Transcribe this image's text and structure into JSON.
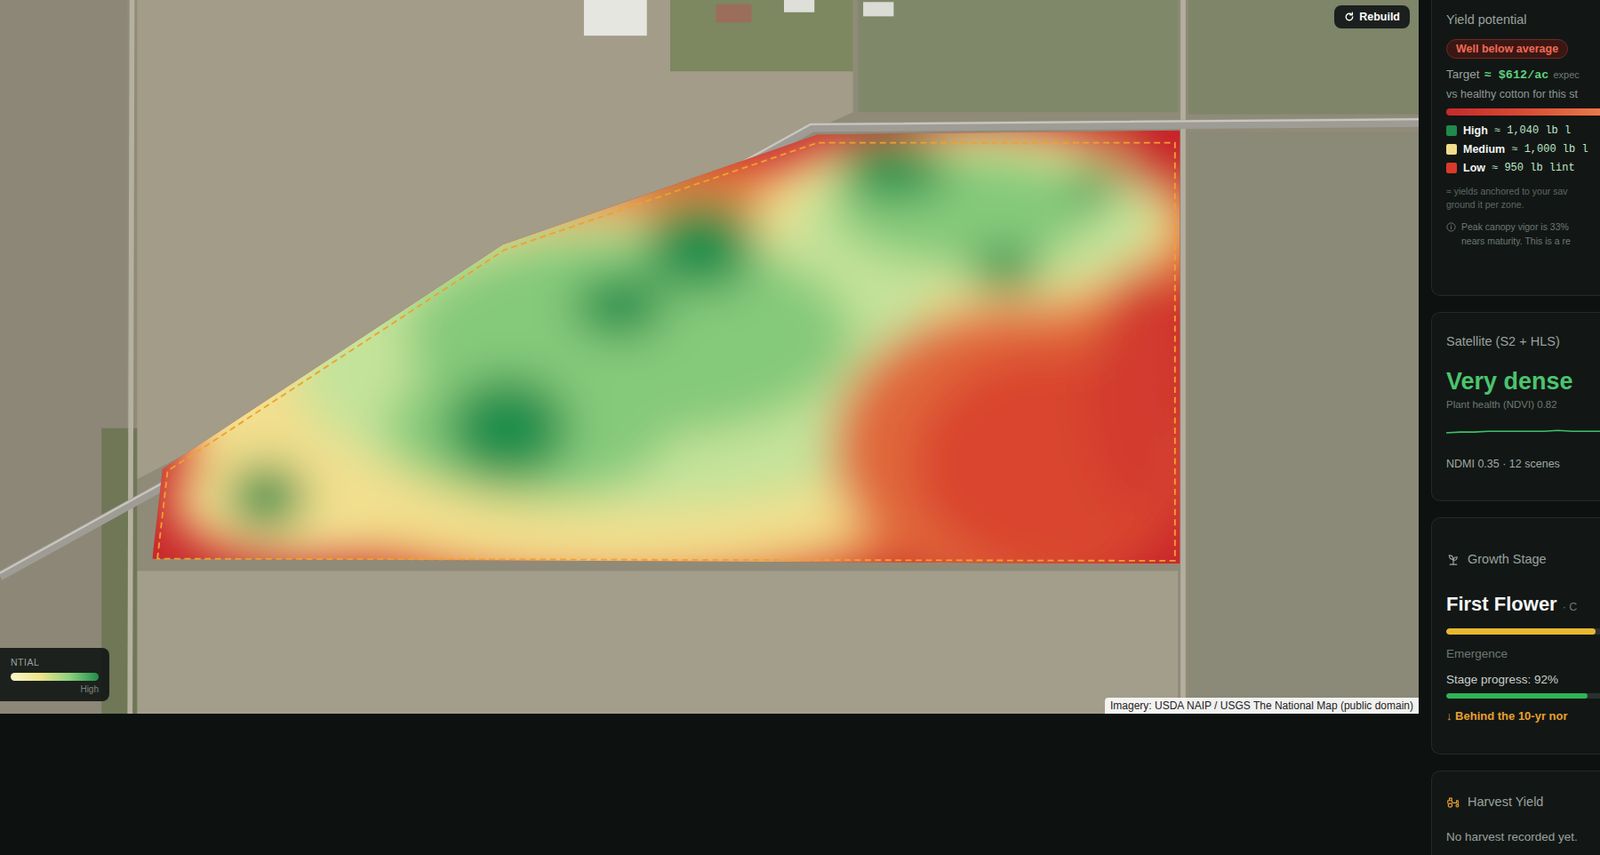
{
  "map": {
    "rebuild_button": {
      "label": "Rebuild"
    },
    "legend": {
      "title": "NTIAL",
      "high_label": "High"
    },
    "attribution": "Imagery: USDA NAIP / USGS The National Map (public domain)"
  },
  "yield_card": {
    "title": "Yield potential",
    "badge": "Well below average",
    "target_label": "Target",
    "target_value": "≈ $612/ac",
    "target_suffix": "expec",
    "comparison": "vs healthy cotton for this st",
    "zones": [
      {
        "label": "High",
        "value": "≈ 1,040 lb l",
        "color": "#1f8a4c"
      },
      {
        "label": "Medium",
        "value": "≈ 1,000 lb l",
        "color": "#f3dc8a"
      },
      {
        "label": "Low",
        "value": "≈ 950 lb lint",
        "color": "#d93a2b"
      }
    ],
    "note_lines": [
      "≈ yields anchored to your sav",
      "ground it per zone."
    ],
    "info_lines": [
      "Peak canopy vigor is 33%",
      "nears maturity. This is a re"
    ]
  },
  "satellite_card": {
    "title": "Satellite (S2 + HLS)",
    "status": "Very dense",
    "ndvi_label": "Plant health (NDVI) 0.82",
    "ndvi_series": [
      0.8,
      0.81,
      0.81,
      0.82,
      0.82,
      0.82,
      0.82,
      0.82,
      0.83,
      0.82,
      0.82,
      0.82
    ],
    "footer": "NDMI 0.35 · 12 scenes"
  },
  "growth_card": {
    "title": "Growth Stage",
    "stage": "First Flower",
    "stage_suffix": "· C",
    "timeline_level": 0.97,
    "previous_stage": "Emergence",
    "progress_label": "Stage progress: 92%",
    "progress_level": 0.92,
    "status": "↓ Behind the 10-yr nor"
  },
  "harvest_card": {
    "title": "Harvest Yield",
    "message": "No harvest recorded yet."
  }
}
